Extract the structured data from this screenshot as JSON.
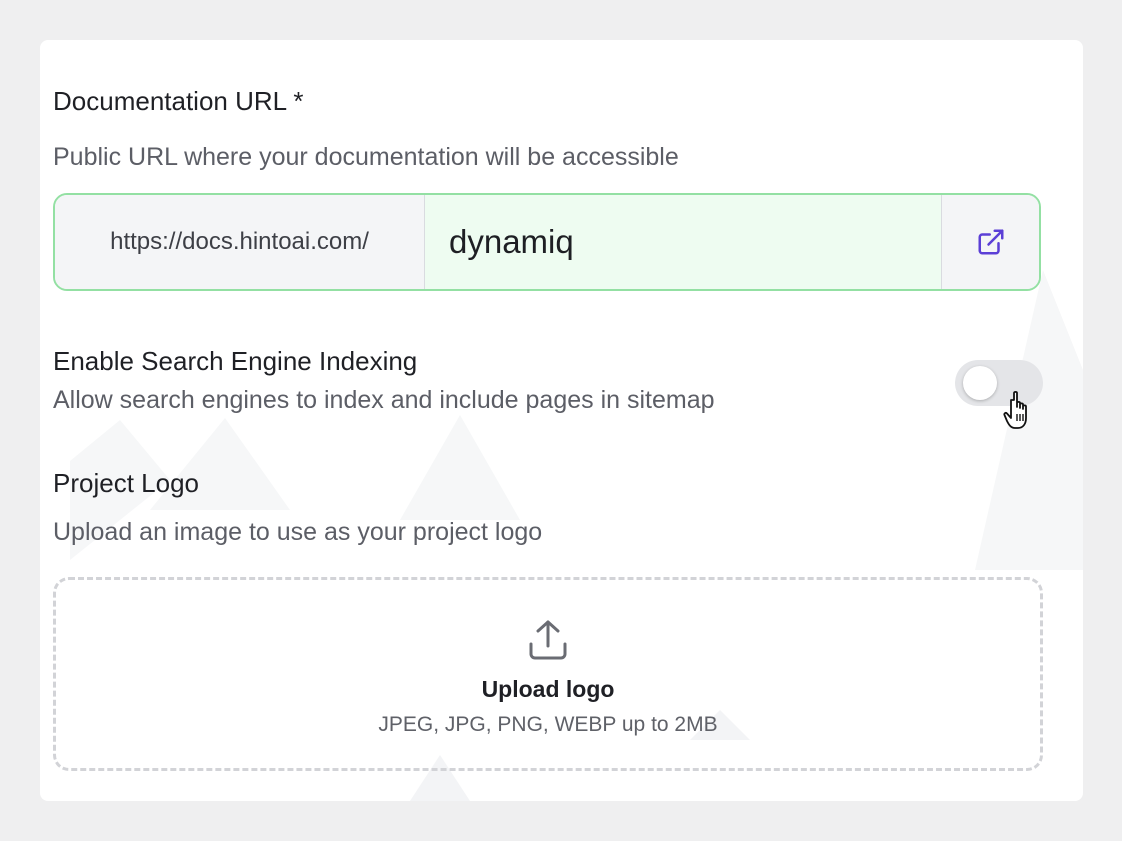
{
  "documentation_url": {
    "label": "Documentation URL *",
    "description": "Public URL where your documentation will be accessible",
    "prefix": "https://docs.hintoai.com/",
    "value": "dynamiq",
    "open_icon": "external-link-icon"
  },
  "search_indexing": {
    "label": "Enable Search Engine Indexing",
    "description": "Allow search engines to index and include pages in sitemap",
    "enabled": false
  },
  "project_logo": {
    "label": "Project Logo",
    "description": "Upload an image to use as your project logo",
    "upload_title": "Upload logo",
    "upload_hint": "JPEG, JPG, PNG, WEBP up to 2MB",
    "upload_icon": "upload-icon"
  },
  "colors": {
    "accent": "#5b3fd6",
    "input_border": "#93e0a3",
    "input_bg": "#eefcf1"
  }
}
